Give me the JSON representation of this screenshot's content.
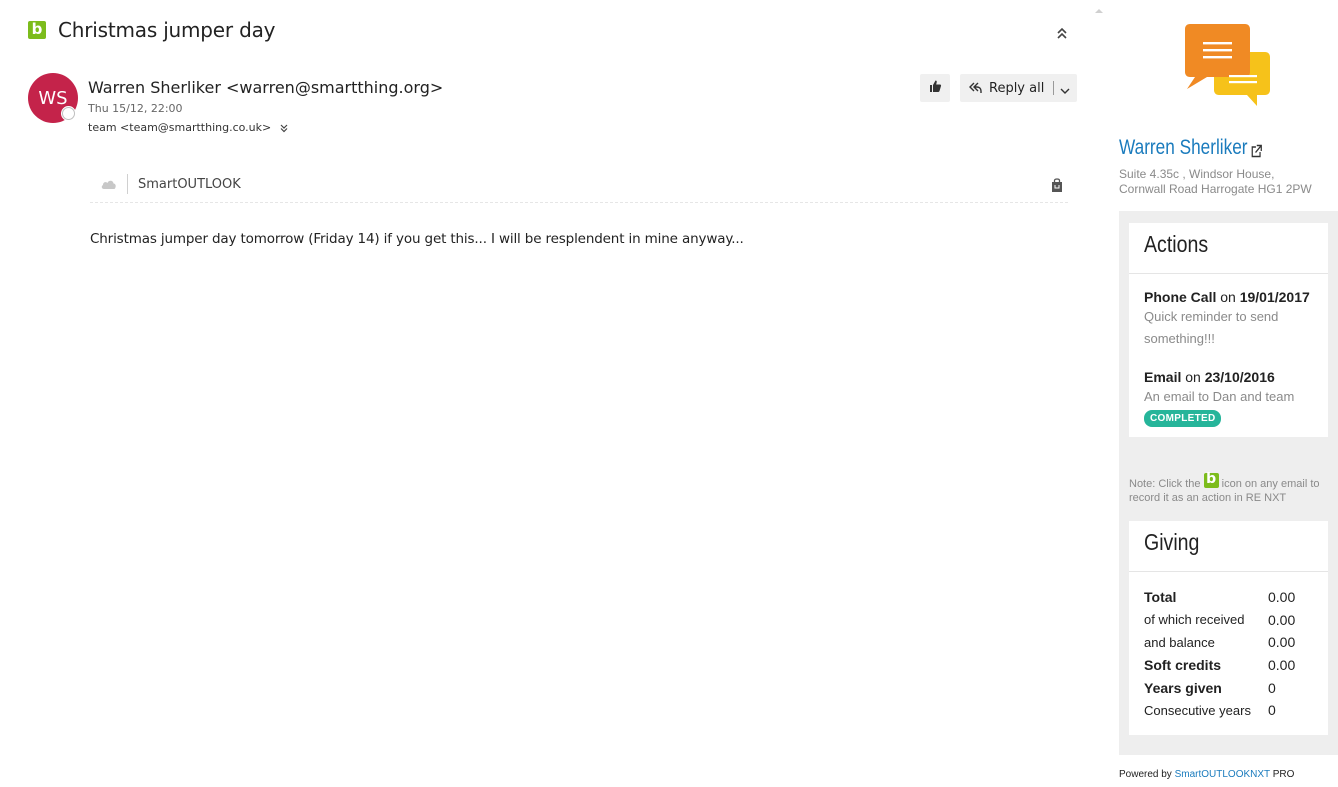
{
  "email": {
    "subject": "Christmas jumper day",
    "avatar_initials": "WS",
    "sender": "Warren Sherliker <warren@smartthing.org>",
    "date": "Thu 15/12, 22:00",
    "to": "team <team@smartthing.co.uk>",
    "reply_label": "Reply all",
    "addin_name": "SmartOUTLOOK",
    "body": "Christmas jumper day tomorrow (Friday 14) if you get this... I will be resplendent in mine anyway..."
  },
  "icons": {
    "addin_b": "b-logo-icon",
    "collapse": "double-chevron-up-icon",
    "like": "thumbs-up-icon",
    "reply_all": "reply-all-icon",
    "more": "chevron-down-icon",
    "expand_recipients": "double-chevron-down-icon",
    "store": "shopping-bag-icon",
    "chat": "chat-bubbles-icon",
    "external": "external-link-icon"
  },
  "sidebar": {
    "contact_name": "Warren Sherliker",
    "address_line1": "Suite 4.35c , Windsor House,",
    "address_line2": "Cornwall Road Harrogate HG1 2PW",
    "actions_title": "Actions",
    "actions": [
      {
        "type": "Phone Call",
        "on": "on",
        "date": "19/01/2017",
        "description": "Quick reminder to send something!!!"
      },
      {
        "type": "Email",
        "on": "on",
        "date": "23/10/2016",
        "description": "An email to Dan and team",
        "status": "COMPLETED"
      }
    ],
    "note_prefix": "Note: Click the",
    "note_suffix": "icon on any email to record it as an action in RE NXT",
    "giving_title": "Giving",
    "giving": [
      {
        "label": "Total",
        "value": "0.00"
      },
      {
        "label": "of which received",
        "value": "0.00"
      },
      {
        "label": "and balance",
        "value": "0.00"
      },
      {
        "label": "Soft credits",
        "value": "0.00"
      },
      {
        "label": "Years given",
        "value": "0"
      },
      {
        "label": "Consecutive years",
        "value": "0"
      }
    ],
    "powered_prefix": "Powered by",
    "powered_link": "SmartOUTLOOKNXT",
    "powered_suffix": "PRO"
  },
  "colors": {
    "avatar": "#c4234a",
    "brand_green": "#7cbc1c",
    "link_blue": "#1a7bbd",
    "badge_teal": "#26b59a",
    "chat_orange": "#f08a24",
    "chat_yellow": "#f6c21a"
  }
}
